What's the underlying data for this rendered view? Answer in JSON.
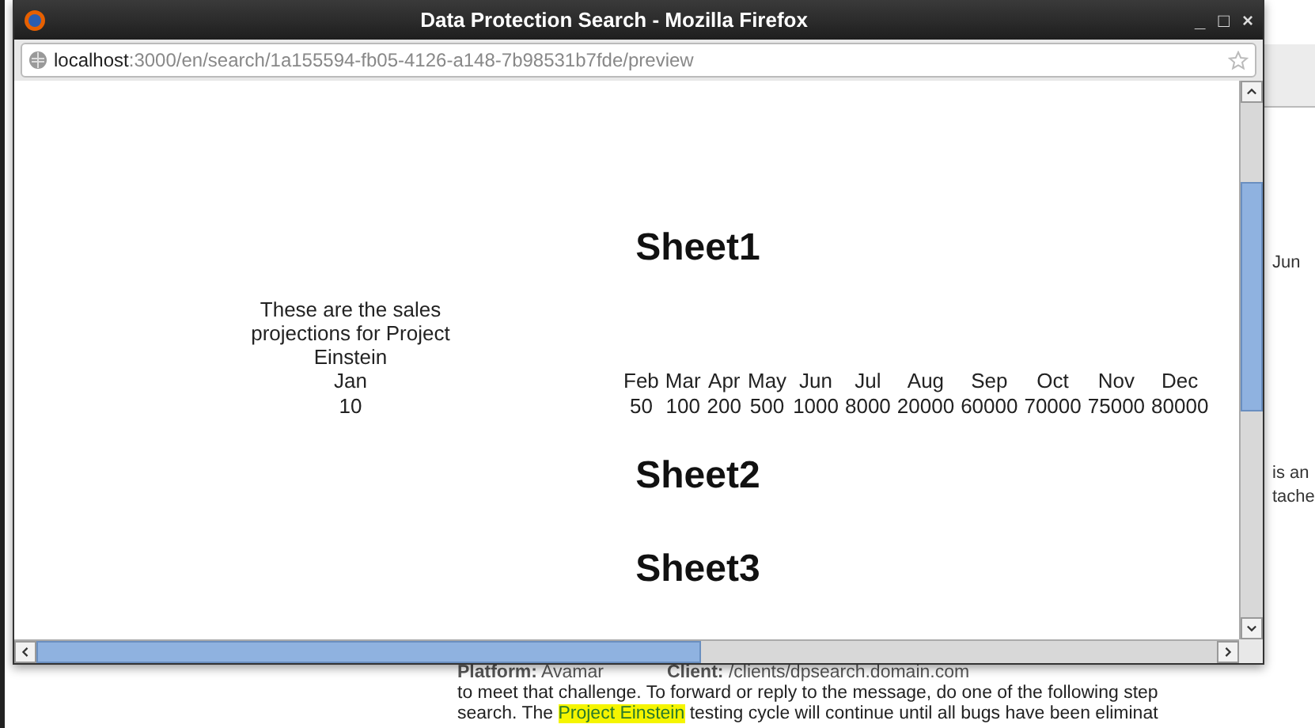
{
  "window": {
    "title": "Data Protection Search - Mozilla Firefox",
    "controls": [
      "_",
      "□",
      "×"
    ],
    "url_host": "localhost",
    "url_path": ":3000/en/search/1a155594-fb05-4126-a148-7b98531b7fde/preview"
  },
  "sheets": [
    {
      "title": "Sheet1",
      "caption": "These are the sales projections for Project Einstein",
      "months": [
        "Jan",
        "Feb",
        "Mar",
        "Apr",
        "May",
        "Jun",
        "Jul",
        "Aug",
        "Sep",
        "Oct",
        "Nov",
        "Dec"
      ],
      "values": [
        "10",
        "50",
        "100",
        "200",
        "500",
        "1000",
        "8000",
        "20000",
        "60000",
        "70000",
        "75000",
        "80000"
      ]
    },
    {
      "title": "Sheet2"
    },
    {
      "title": "Sheet3"
    }
  ],
  "background": {
    "fragments": [
      "Jun",
      "is an",
      "tache"
    ],
    "meta": [
      "**Platform:** Avamar",
      "**Client:** /clients/dpsearch.domain.com"
    ],
    "lines": [
      [
        {
          "text": "to meet that challenge. To forward or reply to the message, do one of the following step",
          "highlight": false
        }
      ],
      [
        {
          "text": "search. The ",
          "highlight": false
        },
        {
          "text": "Project Einstein",
          "highlight": true
        },
        {
          "text": " testing cycle will continue until all bugs have been eliminat",
          "highlight": false
        }
      ]
    ]
  }
}
